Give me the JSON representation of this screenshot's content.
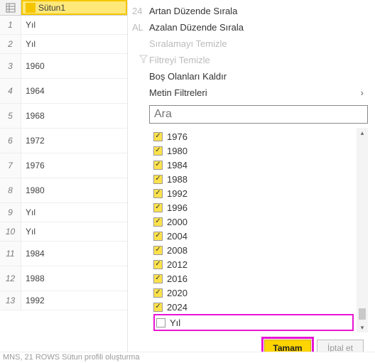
{
  "column": {
    "header": "Sütun1",
    "type_prefix": "A C"
  },
  "rows": [
    {
      "n": "1",
      "v": "Yıl",
      "tall": false
    },
    {
      "n": "2",
      "v": "Yıl",
      "tall": false
    },
    {
      "n": "3",
      "v": "1960",
      "tall": true
    },
    {
      "n": "4",
      "v": "1964",
      "tall": true
    },
    {
      "n": "5",
      "v": "1968",
      "tall": true
    },
    {
      "n": "6",
      "v": "1972",
      "tall": true
    },
    {
      "n": "7",
      "v": "1976",
      "tall": true
    },
    {
      "n": "8",
      "v": "1980",
      "tall": true
    },
    {
      "n": "9",
      "v": "Yıl",
      "tall": false
    },
    {
      "n": "10",
      "v": "Yıl",
      "tall": false
    },
    {
      "n": "11",
      "v": "1984",
      "tall": true
    },
    {
      "n": "12",
      "v": "1988",
      "tall": true
    },
    {
      "n": "13",
      "v": "1992",
      "tall": false
    }
  ],
  "menu": {
    "sort_asc": "Artan Düzende Sırala",
    "sort_asc_prefix": "24",
    "sort_desc": "Azalan Düzende Sırala",
    "sort_desc_prefix": "AL",
    "clear_sort": "Sıralamayı Temizle",
    "clear_filter": "Filtreyi Temizle",
    "remove_empty": "Boş Olanları Kaldır",
    "text_filters": "Metin Filtreleri"
  },
  "search": {
    "placeholder": "Ara"
  },
  "values": [
    {
      "label": "1976",
      "checked": true
    },
    {
      "label": "1980",
      "checked": true
    },
    {
      "label": "1984",
      "checked": true
    },
    {
      "label": "1988",
      "checked": true
    },
    {
      "label": "1992",
      "checked": true
    },
    {
      "label": "1996",
      "checked": true
    },
    {
      "label": "2000",
      "checked": true
    },
    {
      "label": "2004",
      "checked": true
    },
    {
      "label": "2008",
      "checked": true
    },
    {
      "label": "2012",
      "checked": true
    },
    {
      "label": "2016",
      "checked": true
    },
    {
      "label": "2020",
      "checked": true
    },
    {
      "label": "2024",
      "checked": true
    },
    {
      "label": "Yıl",
      "checked": false,
      "highlight": true
    }
  ],
  "buttons": {
    "ok": "Tamam",
    "cancel": "İptal et"
  },
  "status": "MNS, 21 ROWS Sütun profili oluşturma"
}
